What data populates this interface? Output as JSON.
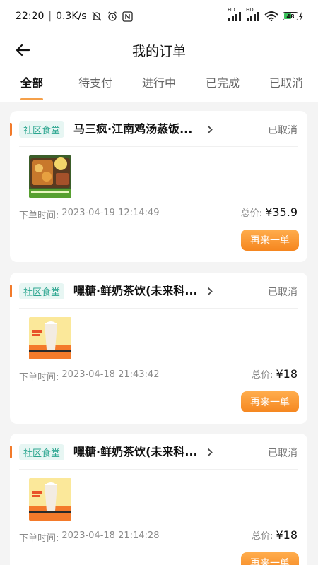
{
  "status_bar": {
    "time": "22:20",
    "speed": "0.3K/s",
    "net_label_1": "HD",
    "net_label_2": "HD",
    "battery_level": "48"
  },
  "header": {
    "title": "我的订单"
  },
  "tabs": [
    {
      "label": "全部",
      "active": true
    },
    {
      "label": "待支付",
      "active": false
    },
    {
      "label": "进行中",
      "active": false
    },
    {
      "label": "已完成",
      "active": false
    },
    {
      "label": "已取消",
      "active": false
    }
  ],
  "orders": [
    {
      "tag": "社区食堂",
      "store": "马三疯·江南鸡汤蒸饭...",
      "status": "已取消",
      "time_label": "下单时间:",
      "time": "2023-04-19 12:14:49",
      "total_label": "总价:",
      "total": "¥35.9",
      "reorder_label": "再来一单",
      "thumb": "food-photo"
    },
    {
      "tag": "社区食堂",
      "store": "嘿糖·鲜奶茶饮(未来科...",
      "status": "已取消",
      "time_label": "下单时间:",
      "time": "2023-04-18 21:43:42",
      "total_label": "总价:",
      "total": "¥18",
      "reorder_label": "再来一单",
      "thumb": "milk-tea-photo"
    },
    {
      "tag": "社区食堂",
      "store": "嘿糖·鲜奶茶饮(未来科...",
      "status": "已取消",
      "time_label": "下单时间:",
      "time": "2023-04-18 21:14:28",
      "total_label": "总价:",
      "total": "¥18",
      "reorder_label": "再来一单",
      "thumb": "milk-tea-photo"
    }
  ],
  "colors": {
    "accent": "#f5a04a",
    "button": "#f5861f",
    "tag_bg": "#e7f6f3",
    "tag_text": "#2da690"
  }
}
